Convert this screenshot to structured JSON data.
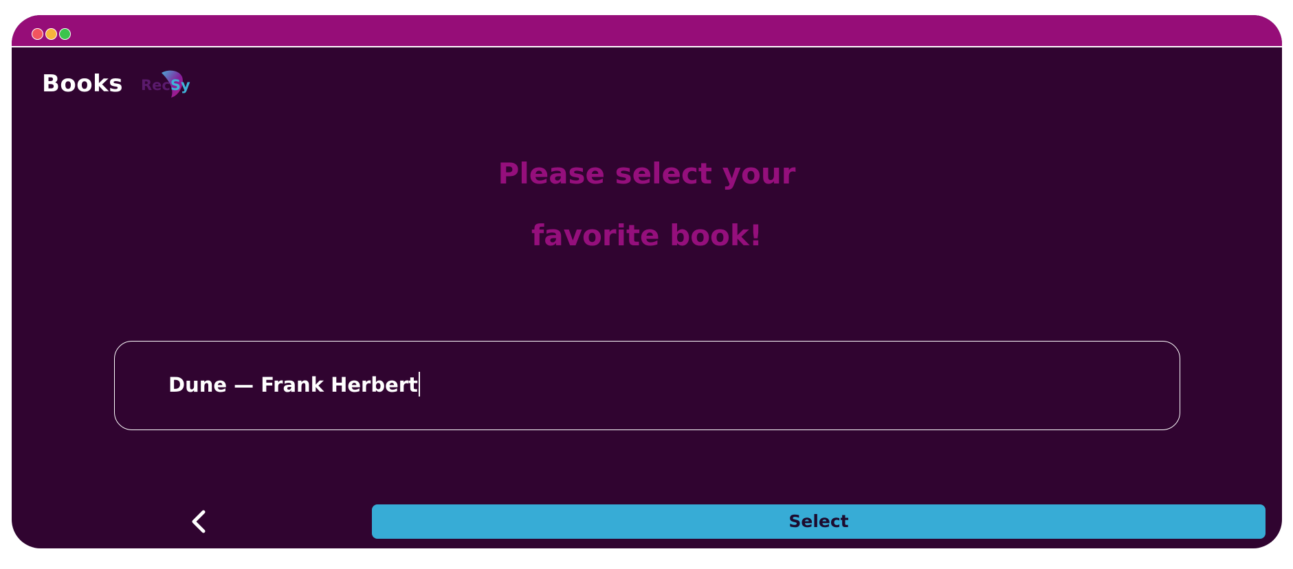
{
  "window": {
    "controls": [
      "close",
      "minimize",
      "maximize"
    ]
  },
  "header": {
    "title": "Books",
    "logo": {
      "text_part1": "Rec",
      "text_part2": "Sy"
    }
  },
  "main": {
    "heading_line1": "Please select your",
    "heading_line2": "favorite book!",
    "book_input": {
      "value": "Dune — Frank Herbert"
    }
  },
  "footer": {
    "back_icon": "chevron-left-icon",
    "select_label": "Select"
  },
  "colors": {
    "background": "#300430",
    "titlebar": "#960d78",
    "heading": "#950f7c",
    "select_button": "#37acd6",
    "select_text": "#1d0b2e"
  }
}
